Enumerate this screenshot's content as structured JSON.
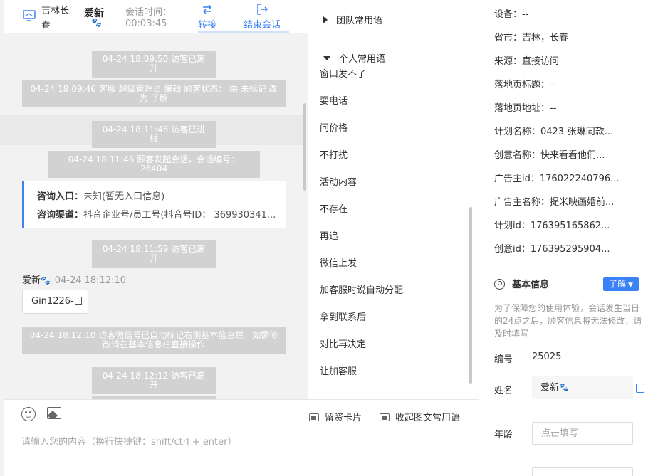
{
  "header": {
    "location": "吉林长春",
    "visitor_name": "爱新",
    "session_time_label": "会话时间：",
    "session_time_value": "00:03:45",
    "transfer_label": "转接",
    "end_label": "结束会话"
  },
  "messages": {
    "sys1": "04-24 18:09:50 访客已离开",
    "sys2": "04-24 18:09:46 客服 超级管理员 编辑 顾客状态： 由 未标记 改为 了解",
    "sys3": "04-24 18:11:46 访客已进线",
    "sys4": "04-24 18:11:46 顾客发起会话，会话编号：26404",
    "entry_label": "咨询入口：",
    "entry_value": "未知(暂无入口信息)",
    "channel_label": "咨询渠道：",
    "channel_value": "抖音企业号/员工号(抖音号ID： 369930341...",
    "sys5": "04-24 18:11:59 访客已离开",
    "sender_name": "爱新",
    "sender_time": "04-24 18:12:10",
    "bubble_text": "Gin1226-",
    "sys6": "04-24 18:12:10 访客微信号已自动标记右侧基本信息栏，如需修改请在基本信息栏直接操作",
    "sys7": "04-24 18:12:12 访客已离开"
  },
  "composer": {
    "card_label": "留资卡片",
    "collapse_label": "收起图文常用语",
    "placeholder": "请输入您的内容（换行快捷键：shift/ctrl + enter）"
  },
  "phrases": {
    "team_title": "团队常用语",
    "personal_title": "个人常用语",
    "items": [
      "窗口发不了",
      "要电话",
      "问价格",
      "不打扰",
      "活动内容",
      "不存在",
      "再追",
      "微信上发",
      "加客服时说自动分配",
      "拿到联系后",
      "对比再决定",
      "让加客服"
    ]
  },
  "visitor_info": {
    "device": "设备：--",
    "province": "省市：吉林，长春",
    "source": "来源：直接访问",
    "landing_title": "落地页标题：--",
    "landing_url": "落地页地址：--",
    "plan_name": "计划名称：0423-张琳同款...",
    "creative_name": "创意名称：快来看看他们...",
    "advertiser_id": "广告主id：176022240796...",
    "advertiser_name": "广告主名称：提米映画婚前...",
    "plan_id": "计划id：176395165862...",
    "creative_id": "创意id：176395295904..."
  },
  "basic_info": {
    "title": "基本信息",
    "status_button": "了解",
    "tip": "为了保障您的使用体验，会话发生当日的24点之后，顾客信息将无法修改，请及时填写",
    "id_label": "编号",
    "id_value": "25025",
    "name_label": "姓名",
    "name_value": "爱新",
    "age_label": "年龄",
    "age_placeholder": "点击填写"
  },
  "colors": {
    "accent": "#3b82f6",
    "system_msg_bg": "#d2d2d2",
    "chat_bg": "#f2f2f2"
  }
}
